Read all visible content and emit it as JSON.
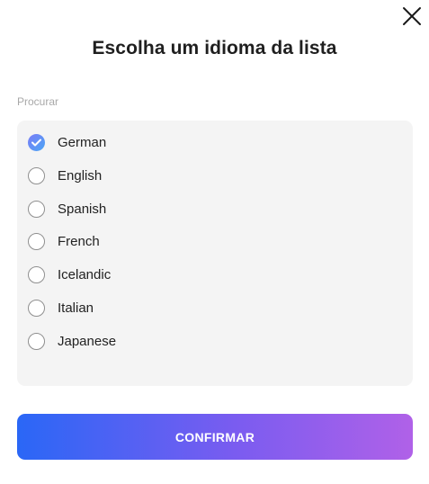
{
  "dialog": {
    "title": "Escolha um idioma da lista",
    "close_icon": "close-icon"
  },
  "search": {
    "placeholder": "Procurar",
    "value": ""
  },
  "languages": [
    {
      "label": "German",
      "selected": true
    },
    {
      "label": "English",
      "selected": false
    },
    {
      "label": "Spanish",
      "selected": false
    },
    {
      "label": "French",
      "selected": false
    },
    {
      "label": "Icelandic",
      "selected": false
    },
    {
      "label": "Italian",
      "selected": false
    },
    {
      "label": "Japanese",
      "selected": false
    }
  ],
  "confirm": {
    "label": "CONFIRMAR"
  },
  "colors": {
    "accent_start": "#2a67f6",
    "accent_end": "#b061e8",
    "list_background": "#f4f4f4"
  }
}
